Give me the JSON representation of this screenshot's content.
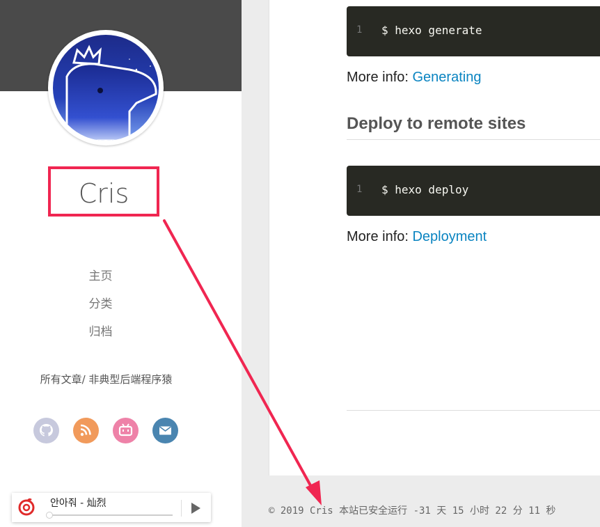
{
  "sidebar": {
    "site_name": "Cris",
    "nav": [
      "主页",
      "分类",
      "归档"
    ],
    "tagline": "所有文章/ 非典型后端程序猿",
    "social": [
      {
        "icon": "github-icon",
        "color": "#c7c9dd"
      },
      {
        "icon": "rss-icon",
        "color": "#f19a5b"
      },
      {
        "icon": "bilibili-icon",
        "color": "#ee82a8"
      },
      {
        "icon": "mail-icon",
        "color": "#4a85b0"
      }
    ]
  },
  "content": {
    "code1": {
      "line_no": "1",
      "text": "$ hexo generate"
    },
    "more1": {
      "label": "More info: ",
      "link": "Generating"
    },
    "heading": "Deploy to remote sites",
    "code2": {
      "line_no": "1",
      "text": "$ hexo deploy"
    },
    "more2": {
      "label": "More info: ",
      "link": "Deployment"
    }
  },
  "footer": {
    "text": "© 2019 Cris 本站已安全运行 -31 天 15 小时 22 分 11 秒"
  },
  "player": {
    "title": "안아줘 - 灿烈",
    "progress": 0
  },
  "colors": {
    "annotation": "#f02651",
    "link": "#0a84c1",
    "code_bg": "#282923"
  }
}
